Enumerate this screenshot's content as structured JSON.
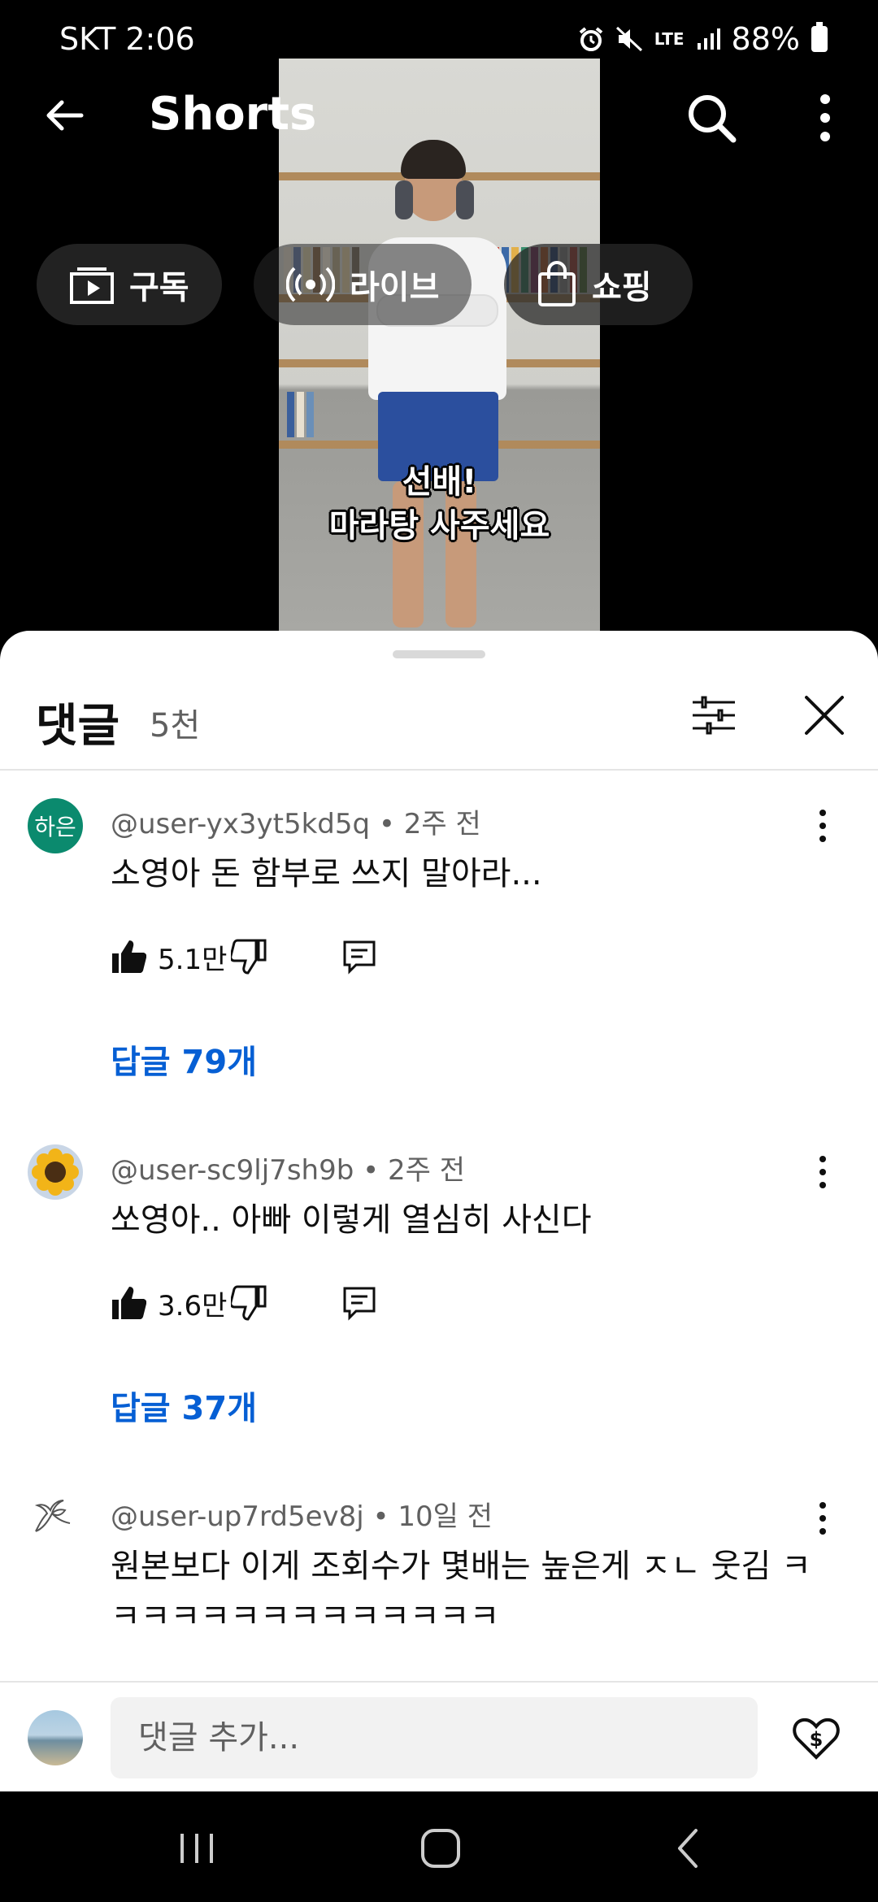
{
  "status_bar": {
    "carrier_time": "SKT 2:06",
    "network": "LTE",
    "battery": "88%"
  },
  "top_bar": {
    "title": "Shorts"
  },
  "chips": [
    {
      "label": "구독",
      "icon": "subscriptions-icon"
    },
    {
      "label": "라이브",
      "icon": "live-icon"
    },
    {
      "label": "쇼핑",
      "icon": "shopping-bag-icon"
    }
  ],
  "video": {
    "caption_line1": "선배!",
    "caption_line2": "마라탕 사주세요"
  },
  "comments_sheet": {
    "title": "댓글",
    "count": "5천",
    "comments": [
      {
        "author": "@user-yx3yt5kd5q",
        "age": "2주 전",
        "avatar_text": "하은",
        "text": "소영아 돈 함부로 쓰지 말아라...",
        "likes": "5.1만",
        "replies": "답글 79개"
      },
      {
        "author": "@user-sc9lj7sh9b",
        "age": "2주 전",
        "text": "쏘영아.. 아빠 이렇게 열심히 사신다",
        "likes": "3.6만",
        "replies": "답글 37개"
      },
      {
        "author": "@user-up7rd5ev8j",
        "age": "10일 전",
        "text": "원본보다 이게 조회수가 몇배는 높은게 ㅈㄴ 웃김 ㅋㅋㅋㅋㅋㅋㅋㅋㅋㅋㅋㅋㅋㅋ"
      }
    ],
    "input_placeholder": "댓글 추가..."
  },
  "colors": {
    "link": "#065fd4",
    "sheet_bg": "#ffffff",
    "secondary_text": "#606060"
  }
}
